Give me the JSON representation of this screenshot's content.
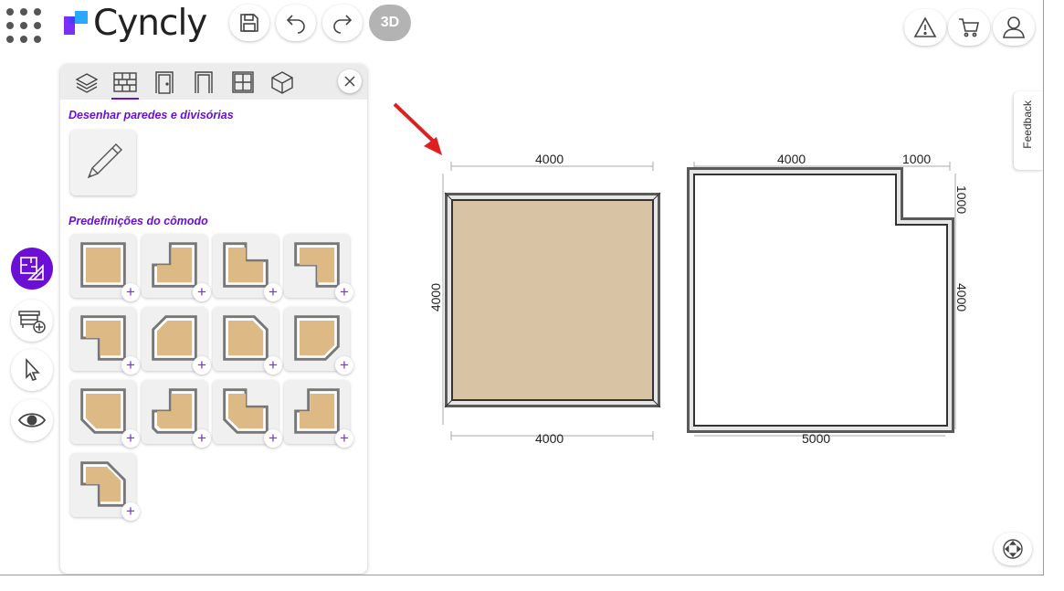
{
  "header": {
    "logo_text": "Cyncly",
    "btn_3d_label": "3D",
    "icons": [
      "apps-grid-icon",
      "save-icon",
      "undo-icon",
      "redo-icon",
      "warning-icon",
      "cart-icon",
      "user-icon"
    ]
  },
  "side_toolbar": {
    "items": [
      "floor-plan-icon",
      "furniture-add-icon",
      "pointer-icon",
      "eye-icon"
    ],
    "active_color": "#6c0fd6"
  },
  "panel": {
    "tabs": [
      "layers-icon",
      "wall-icon",
      "door-icon",
      "opening-icon",
      "window-icon",
      "cube-icon"
    ],
    "active_tab": "wall-icon",
    "section_draw": "Desenhar paredes e divisórias",
    "section_presets": "Predefinições do cômodo",
    "preset_count": 13,
    "plus_label": "+"
  },
  "canvas": {
    "room1": {
      "top": "4000",
      "left": "4000",
      "bottom": "4000"
    },
    "room2": {
      "top_main": "4000",
      "top_notch": "1000",
      "right_notch": "1000",
      "right_main": "4000",
      "bottom": "5000"
    },
    "floor_color": "#d9c3a5"
  },
  "feedback_label": "Feedback"
}
